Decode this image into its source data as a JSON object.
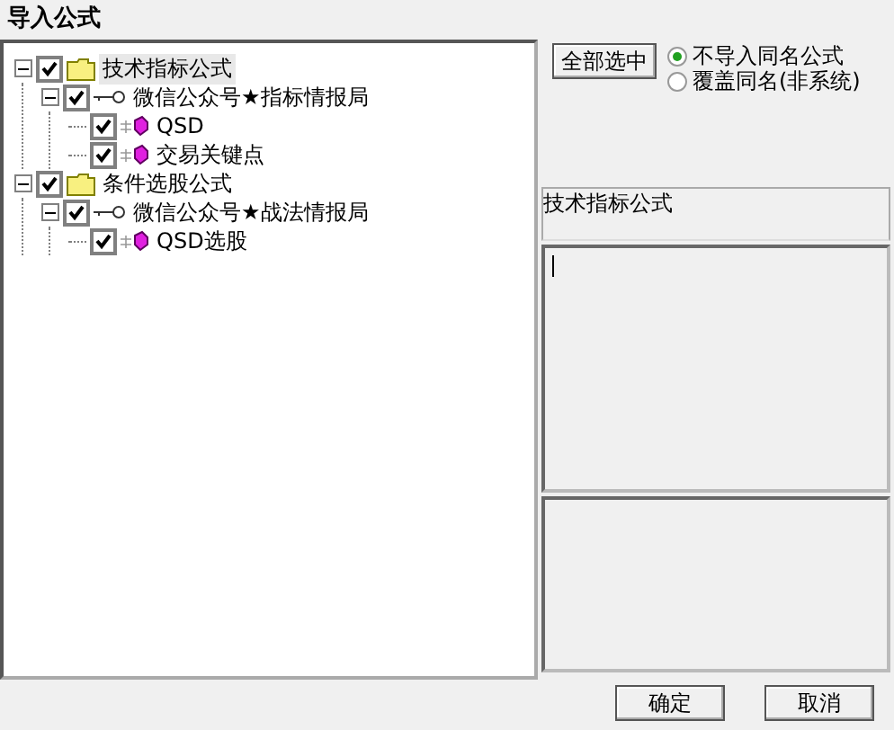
{
  "window": {
    "title": "导入公式"
  },
  "tree": [
    {
      "kind": "folder",
      "label": "技术指标公式",
      "checked": true,
      "expanded": true,
      "selected": true,
      "children": [
        {
          "kind": "group",
          "label": "微信公众号★指标情报局",
          "checked": true,
          "expanded": true,
          "selected": false,
          "children": [
            {
              "kind": "formula",
              "label": "QSD",
              "checked": true,
              "selected": false
            },
            {
              "kind": "formula",
              "label": "交易关键点",
              "checked": true,
              "selected": false
            }
          ]
        }
      ]
    },
    {
      "kind": "folder",
      "label": "条件选股公式",
      "checked": true,
      "expanded": true,
      "selected": false,
      "children": [
        {
          "kind": "group",
          "label": "微信公众号★战法情报局",
          "checked": true,
          "expanded": true,
          "selected": false,
          "children": [
            {
              "kind": "formula",
              "label": "QSD选股",
              "checked": true,
              "selected": false
            }
          ]
        }
      ]
    }
  ],
  "select_all_button": "全部选中",
  "options": [
    {
      "label": "不导入同名公式",
      "selected": true
    },
    {
      "label": "覆盖同名(非系统)",
      "selected": false
    }
  ],
  "name_box": "技术指标公式",
  "buttons": [
    "确定",
    "取消"
  ]
}
